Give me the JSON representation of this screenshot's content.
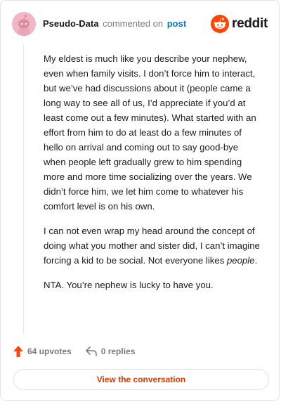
{
  "header": {
    "username": "Pseudo-Data",
    "action": "commented on",
    "link": "post",
    "brand": "reddit"
  },
  "comment": {
    "paragraphs": [
      "My eldest is much like you describe your nephew, even when family visits. I don’t force him to interact, but we’ve had discussions about it (people came a long way to see all of us, I’d appreciate if you’d at least come out a few minutes). What started with an effort from him to do at least do a few minutes of hello on arrival and coming out to say good-bye when people left gradually grew to him spending more and more time socializing over the years. We didn’t force him, we let him come to whatever his comfort level is on his own.",
      "I can not even wrap my head around the concept of doing what you mother and sister did, I can’t imagine forcing a kid to be social. Not everyone likes ",
      "NTA. You’re nephew is lucky to have you."
    ],
    "emphasis": "people",
    "emphasis_tail": "."
  },
  "footer": {
    "upvotes": "64 upvotes",
    "replies": "0 replies"
  },
  "cta": {
    "label": "View the conversation"
  },
  "colors": {
    "accent": "#d93a00",
    "link": "#0079d3",
    "upvote": "#ff4500",
    "avatar_bg": "#f2b6c6"
  }
}
